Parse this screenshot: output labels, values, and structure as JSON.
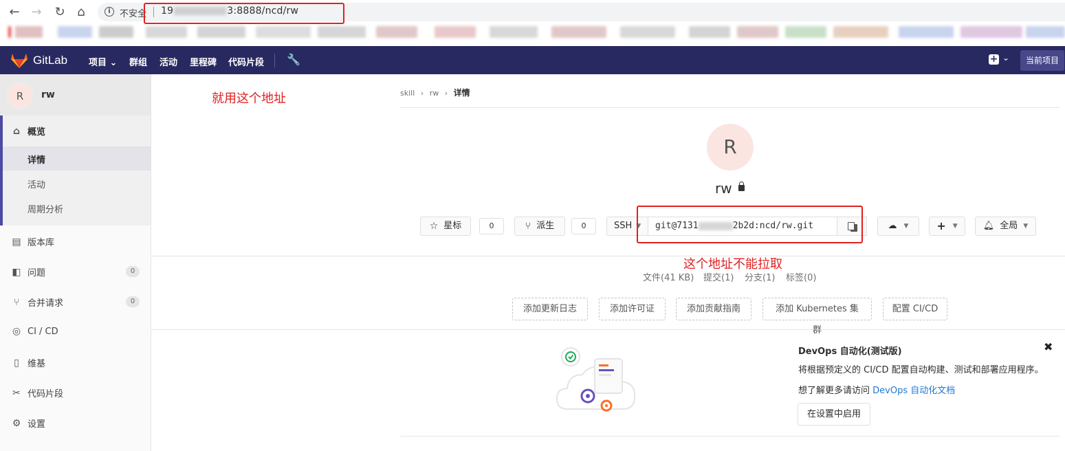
{
  "browser": {
    "insecure_label": "不安全",
    "url_prefix": "19",
    "url_suffix": "3:8888/ncd/rw"
  },
  "header": {
    "brand": "GitLab",
    "menu": [
      "项目",
      "群组",
      "活动",
      "里程碑",
      "代码片段"
    ],
    "current_project": "当前项目"
  },
  "sidebar": {
    "avatar_letter": "R",
    "project_name": "rw",
    "overview_label": "概览",
    "sub_items": [
      "详情",
      "活动",
      "周期分析"
    ],
    "items": [
      {
        "label": "版本库"
      },
      {
        "label": "问题",
        "count": "0"
      },
      {
        "label": "合并请求",
        "count": "0"
      },
      {
        "label": "CI / CD"
      },
      {
        "label": "维基"
      },
      {
        "label": "代码片段"
      },
      {
        "label": "设置"
      }
    ]
  },
  "annotations": {
    "use_this": "就用这个地址",
    "cannot_pull": "这个地址不能拉取"
  },
  "breadcrumb": [
    "skill",
    "rw",
    "详情"
  ],
  "project": {
    "avatar_letter": "R",
    "name": "rw",
    "star_label": "星标",
    "star_count": "0",
    "fork_label": "派生",
    "fork_count": "0",
    "protocol": "SSH",
    "clone_prefix": "git@7131",
    "clone_suffix": "2b2d:ncd/rw.git",
    "notify_label": "全局"
  },
  "stats": {
    "files": "文件(41 KB)",
    "commits": "提交(1)",
    "branches": "分支(1)",
    "tags": "标签(0)"
  },
  "actions": [
    "添加更新日志",
    "添加许可证",
    "添加贡献指南",
    "添加 Kubernetes 集群",
    "配置 CI/CD"
  ],
  "devops": {
    "title": "DevOps 自动化(测试版)",
    "desc": "将根据预定义的 CI/CD 配置自动构建、测试和部署应用程序。",
    "more_prefix": "想了解更多请访问 ",
    "more_link": "DevOps 自动化文档",
    "enable_label": "在设置中启用"
  },
  "colors": {
    "header_bg": "#292961",
    "annotation_red": "#e02020",
    "link": "#1f78d1"
  }
}
